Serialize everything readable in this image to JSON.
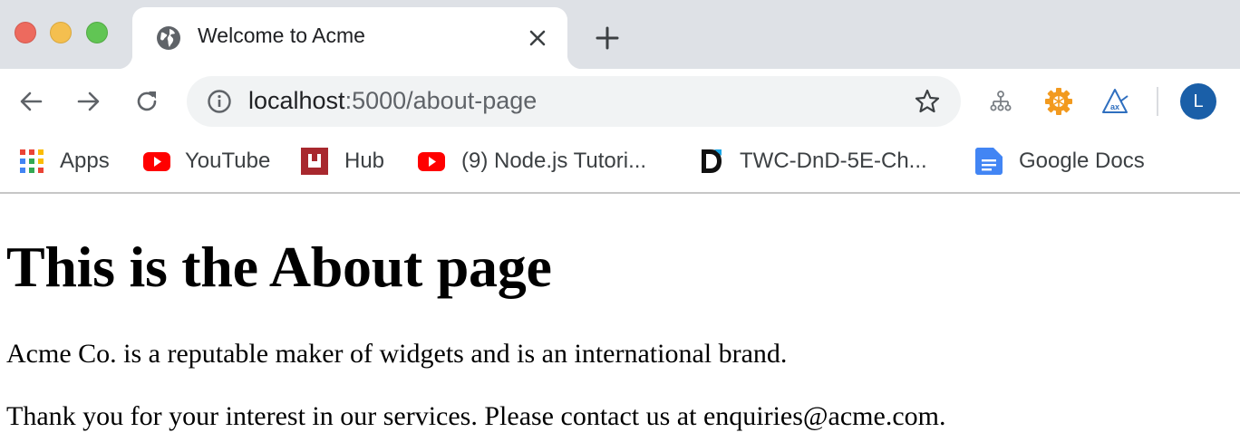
{
  "window": {
    "tab": {
      "title": "Welcome to Acme",
      "favicon": "globe-icon"
    }
  },
  "toolbar": {
    "url_host": "localhost",
    "url_path": ":5000/about-page",
    "avatar_letter": "L",
    "avatar_color": "#1a5fa8",
    "extensions": [
      "sitemap-icon",
      "settings-gear-extension-icon",
      "axe-devtools-icon"
    ]
  },
  "bookmarks": [
    {
      "label": "Apps",
      "icon": "apps-grid-icon"
    },
    {
      "label": "YouTube",
      "icon": "youtube-icon"
    },
    {
      "label": "Hub",
      "icon": "hub-icon"
    },
    {
      "label": "(9) Node.js Tutori...",
      "icon": "youtube-icon"
    },
    {
      "label": "TWC-DnD-5E-Ch...",
      "icon": "dndbeyond-icon"
    },
    {
      "label": "Google Docs",
      "icon": "google-docs-icon"
    }
  ],
  "page": {
    "heading": "This is the About page",
    "paragraph1": "Acme Co. is a reputable maker of widgets and is an international brand.",
    "paragraph2": "Thank you for your interest in our services. Please contact us at enquiries@acme.com."
  }
}
